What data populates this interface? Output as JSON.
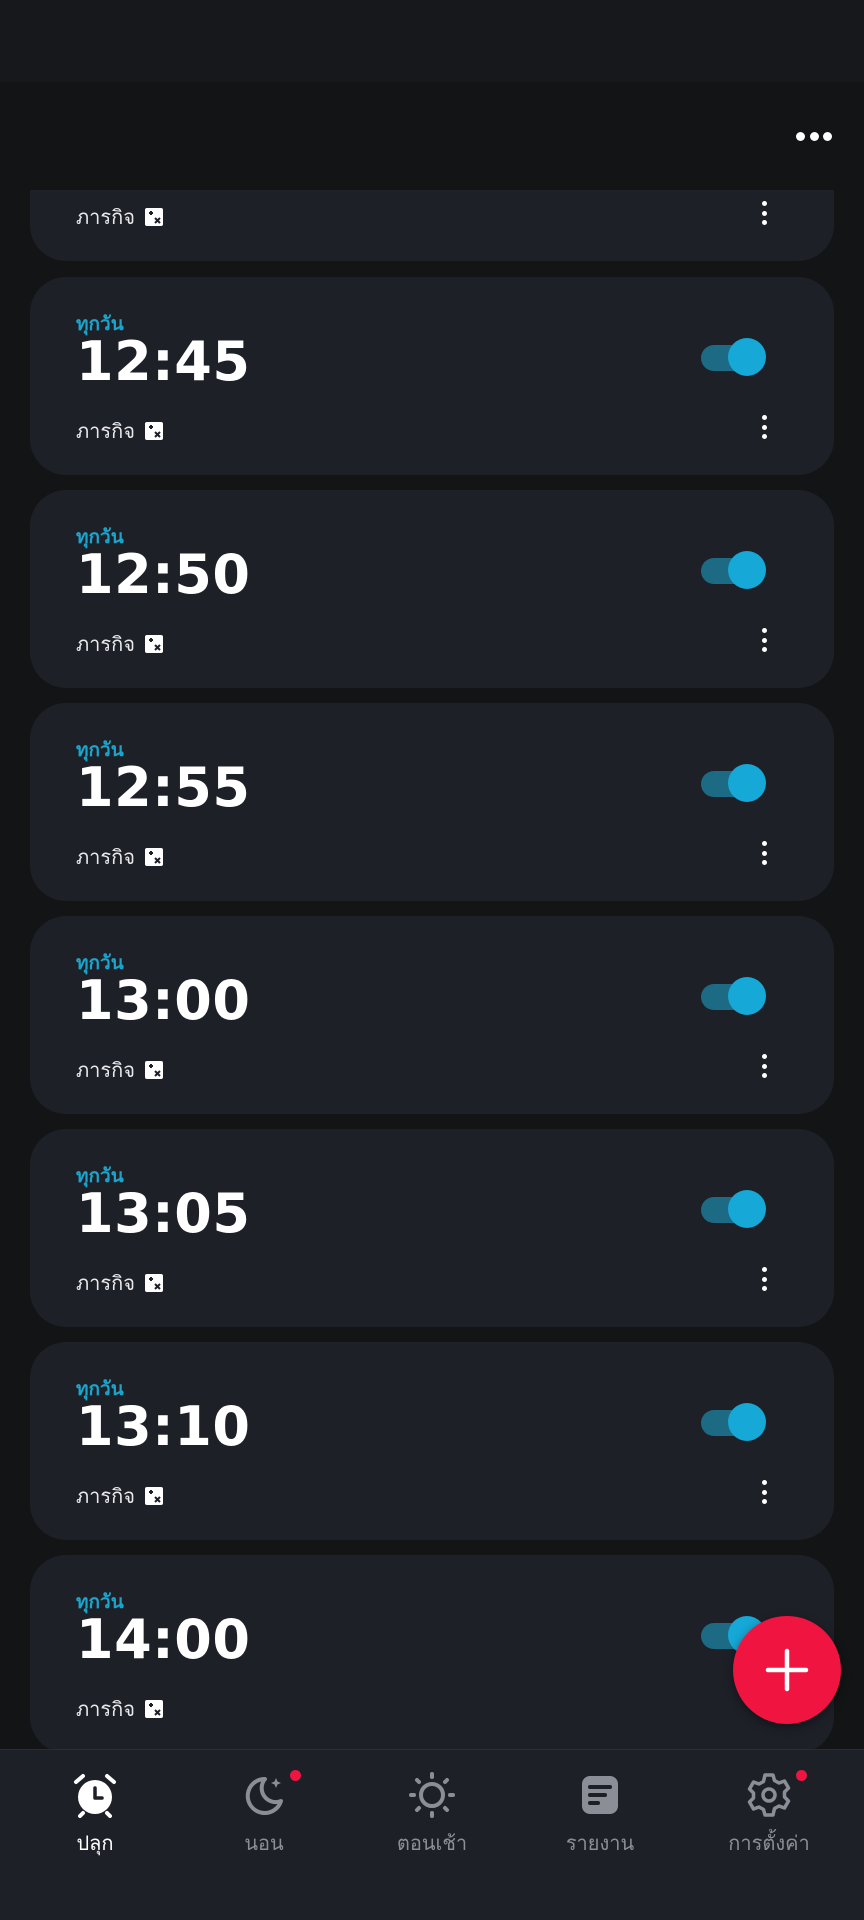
{
  "header": {
    "more_icon": "more-horizontal-icon"
  },
  "alarms": [
    {
      "repeat": "",
      "time": "",
      "label": "ภารกิจ",
      "enabled": true
    },
    {
      "repeat": "ทุกวัน",
      "time": "12:45",
      "label": "ภารกิจ",
      "enabled": true
    },
    {
      "repeat": "ทุกวัน",
      "time": "12:50",
      "label": "ภารกิจ",
      "enabled": true
    },
    {
      "repeat": "ทุกวัน",
      "time": "12:55",
      "label": "ภารกิจ",
      "enabled": true
    },
    {
      "repeat": "ทุกวัน",
      "time": "13:00",
      "label": "ภารกิจ",
      "enabled": true
    },
    {
      "repeat": "ทุกวัน",
      "time": "13:05",
      "label": "ภารกิจ",
      "enabled": true
    },
    {
      "repeat": "ทุกวัน",
      "time": "13:10",
      "label": "ภารกิจ",
      "enabled": true
    },
    {
      "repeat": "ทุกวัน",
      "time": "14:00",
      "label": "ภารกิจ",
      "enabled": true
    }
  ],
  "fab": {
    "icon": "plus-icon"
  },
  "nav": {
    "items": [
      {
        "label": "ปลุก",
        "icon": "alarm-clock-icon",
        "active": true,
        "badge": false
      },
      {
        "label": "นอน",
        "icon": "moon-icon",
        "active": false,
        "badge": true
      },
      {
        "label": "ตอนเช้า",
        "icon": "sun-icon",
        "active": false,
        "badge": false
      },
      {
        "label": "รายงาน",
        "icon": "report-icon",
        "active": false,
        "badge": false
      },
      {
        "label": "การตั้งค่า",
        "icon": "gear-icon",
        "active": false,
        "badge": true
      }
    ]
  },
  "colors": {
    "accent": "#1ba4cc",
    "toggle_on": "#16a8d6",
    "fab": "#f01441",
    "card_bg": "#1e2028",
    "page_bg": "#131416"
  }
}
